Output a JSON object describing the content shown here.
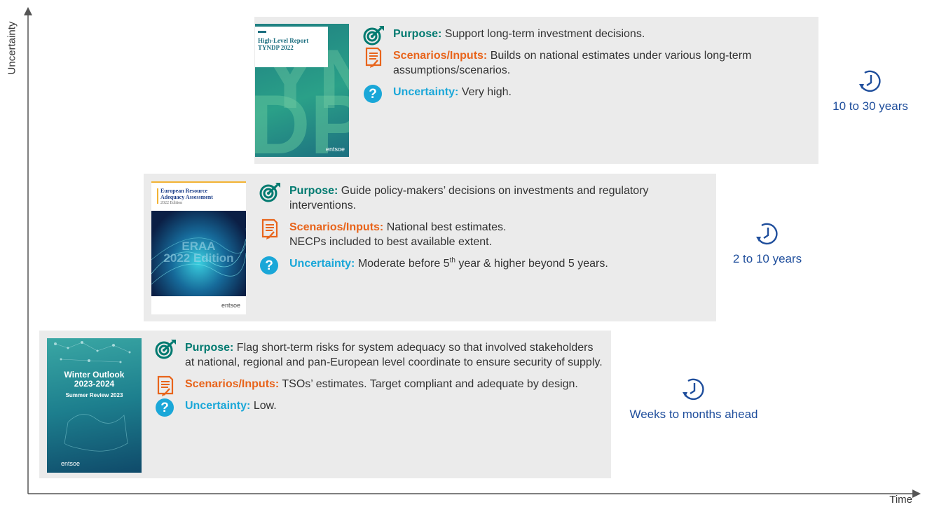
{
  "axes": {
    "y_label": "Uncertainty",
    "x_label": "Time"
  },
  "colors": {
    "purpose": "#007a70",
    "scenarios": "#e8641b",
    "uncertainty": "#1aa7d8",
    "horizon": "#1f4e9c",
    "panel": "#ebebeb"
  },
  "labels": {
    "purpose": "Purpose:",
    "scenarios": "Scenarios/Inputs:",
    "uncertainty": "Uncertainty:"
  },
  "panels": [
    {
      "cover": {
        "title_line1": "High-Level Report",
        "title_line2": "TYNDP 2022",
        "big_text": "TYNDP",
        "brand": "entsoe"
      },
      "purpose": "Support long-term investment decisions.",
      "scenarios": "Builds on national estimates under various long-term assumptions/scenarios.",
      "uncertainty": "Very high.",
      "horizon": "10 to 30 years"
    },
    {
      "cover": {
        "title_line1": "European Resource",
        "title_line2": "Adequacy Assessment",
        "subtitle": "2022 Edition",
        "big_line1": "ERAA",
        "big_line2": "2022 Edition",
        "brand": "entsoe"
      },
      "purpose": "Guide policy-makers’ decisions on investments and regulatory interventions.",
      "scenarios_line1": "National best estimates.",
      "scenarios_line2": "NECPs included to best available extent.",
      "uncertainty_pre": "Moderate before 5",
      "uncertainty_sup": "th",
      "uncertainty_post": " year & higher beyond 5 years.",
      "horizon": "2 to 10 years"
    },
    {
      "cover": {
        "title_line1": "Winter Outlook",
        "title_line2": "2023-2024",
        "subtitle": "Summer Review 2023",
        "brand": "entsoe"
      },
      "purpose": "Flag short-term risks for system adequacy so that involved stakeholders at national, regional and pan-European level coordinate to ensure security of supply.",
      "scenarios": "TSOs’ estimates. Target compliant and adequate by design.",
      "uncertainty": "Low.",
      "horizon": "Weeks to months ahead"
    }
  ]
}
